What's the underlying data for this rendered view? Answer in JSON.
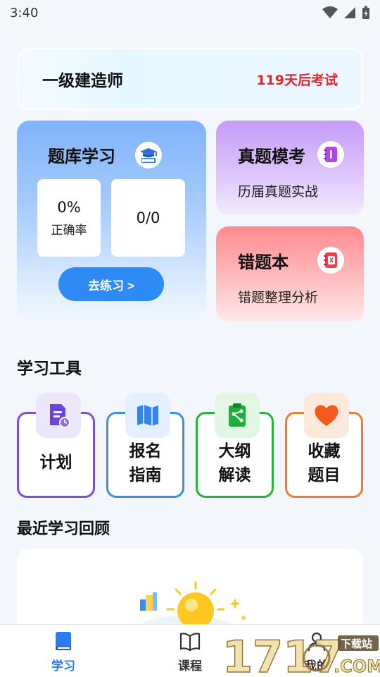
{
  "status_bar": {
    "time": "3:40"
  },
  "exam": {
    "title": "一级建造师",
    "countdown": "119天后考试"
  },
  "question_bank": {
    "title": "题库学习",
    "accuracy_value": "0%",
    "accuracy_label": "正确率",
    "progress_value": "0/0",
    "practice_button": "去练习 >"
  },
  "mock_exam": {
    "title": "真题模考",
    "subtitle": "历届真题实战"
  },
  "wrong_book": {
    "title": "错题本",
    "subtitle": "错题整理分析"
  },
  "tools": {
    "section_title": "学习工具",
    "items": [
      {
        "line1": "计划",
        "line2": "",
        "icon": "plan-document-icon",
        "color": "#7a4fe0"
      },
      {
        "line1": "报名",
        "line2": "指南",
        "icon": "map-icon",
        "color": "#3a8ef3"
      },
      {
        "line1": "大纲",
        "line2": "解读",
        "icon": "clipboard-share-icon",
        "color": "#27b33b"
      },
      {
        "line1": "收藏",
        "line2": "题目",
        "icon": "heart-icon",
        "color": "#f37b2d"
      }
    ]
  },
  "review": {
    "section_title": "最近学习回顾"
  },
  "tab_bar": {
    "items": [
      {
        "label": "学习",
        "active": true,
        "icon": "book-icon",
        "color": "#2a7cf0"
      },
      {
        "label": "课程",
        "active": false,
        "icon": "open-book-icon",
        "color": "#333333"
      },
      {
        "label": "我的",
        "active": false,
        "icon": "person-icon",
        "color": "#333333"
      }
    ]
  },
  "watermark": {
    "number": "1717",
    "text": "下载站",
    "domain": ".COM"
  }
}
